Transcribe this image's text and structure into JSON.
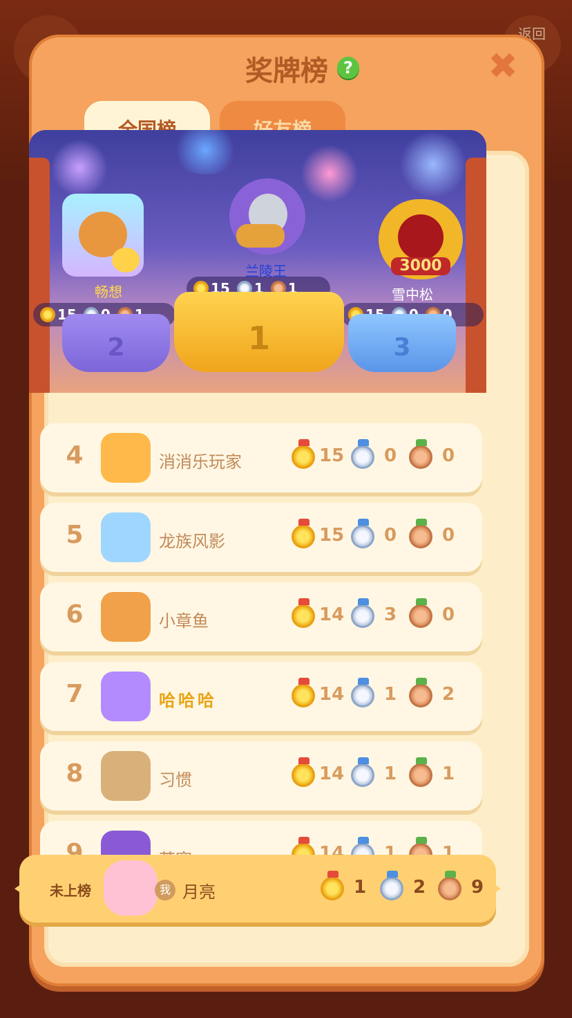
{
  "background": {
    "title": "",
    "back_label": "返回"
  },
  "modal": {
    "title": "奖牌榜",
    "help_icon": "?",
    "close_icon": "✖",
    "tabs": [
      {
        "label": "全国榜",
        "active": true
      },
      {
        "label": "好友榜",
        "active": false
      }
    ]
  },
  "podium": {
    "first": {
      "rank": "1",
      "name": "兰陵王",
      "gold": "15",
      "silver": "1",
      "bronze": "1"
    },
    "second": {
      "rank": "2",
      "name": "畅想",
      "gold": "15",
      "silver": "0",
      "bronze": "1"
    },
    "third": {
      "rank": "3",
      "name": "雪中松",
      "gold": "15",
      "silver": "0",
      "bronze": "0",
      "avatar_frame_text": "3000"
    }
  },
  "rows": [
    {
      "rank": "4",
      "name": "消消乐玩家",
      "gold": "15",
      "silver": "0",
      "bronze": "0"
    },
    {
      "rank": "5",
      "name": "龙族风影",
      "gold": "15",
      "silver": "0",
      "bronze": "0"
    },
    {
      "rank": "6",
      "name": "小章鱼",
      "gold": "14",
      "silver": "3",
      "bronze": "0"
    },
    {
      "rank": "7",
      "name": "哈哈哈",
      "gold": "14",
      "silver": "1",
      "bronze": "2"
    },
    {
      "rank": "8",
      "name": "习惯",
      "gold": "14",
      "silver": "1",
      "bronze": "1"
    },
    {
      "rank": "9",
      "name": "苍穹",
      "gold": "14",
      "silver": "1",
      "bronze": "1"
    }
  ],
  "self": {
    "status": "未上榜",
    "me_badge": "我",
    "name": "月亮",
    "gold": "1",
    "silver": "2",
    "bronze": "9"
  },
  "colors": {
    "gold": "#f0b21a",
    "silver": "#b8c6dc",
    "bronze": "#d98a5a",
    "accent": "#f5a35e"
  }
}
